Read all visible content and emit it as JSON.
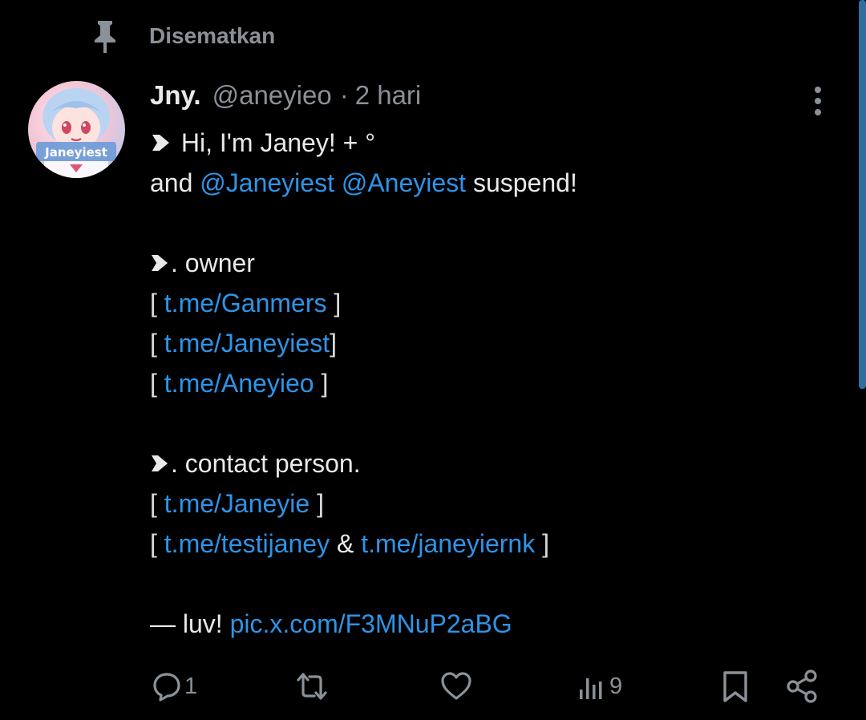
{
  "pinned": {
    "label": "Disematkan",
    "icon": "pin-icon"
  },
  "tweet": {
    "display_name": "Jny.",
    "handle": "@aneyieo",
    "separator": "·",
    "time": "2 hari",
    "avatar_text": "Janeyiest",
    "lines": {
      "hi": "Hi, I'm Janey!  + °",
      "and": "and",
      "mention1": "@Janeyiest",
      "mention2": "@Aneyiest",
      "suspend": "suspend!",
      "owner": ". owner",
      "owner_link1": "t.me/Ganmers",
      "owner_link2": "t.me/Janeyiest",
      "owner_link3": "t.me/Aneyieo",
      "contact": ". contact person.",
      "contact_link1": "t.me/Janeyie",
      "contact_link2": "t.me/testijaney",
      "amp": "&",
      "contact_link3": "t.me/janeyiernk",
      "luv": "— luv!",
      "pic_link": "pic.x.com/F3MNuP2aBG",
      "open_bracket": "[",
      "close_bracket": "]"
    }
  },
  "actions": {
    "reply_count": "1",
    "retweet_count": "",
    "like_count": "",
    "views_count": "9"
  },
  "colors": {
    "background": "#000000",
    "text": "#e7e9ea",
    "muted": "#8b9198",
    "link": "#2e94e8",
    "scrollbar": "#2f6f9e"
  }
}
